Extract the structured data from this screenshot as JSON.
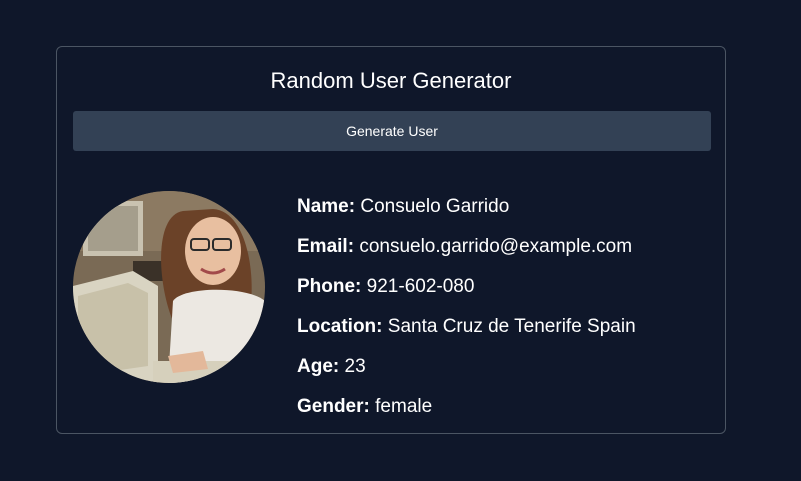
{
  "app": {
    "title": "Random User Generator",
    "generate_label": "Generate User"
  },
  "user": {
    "fields": [
      {
        "label": "Name:",
        "value": "Consuelo Garrido"
      },
      {
        "label": "Email:",
        "value": "consuelo.garrido@example.com"
      },
      {
        "label": "Phone:",
        "value": "921-602-080"
      },
      {
        "label": "Location:",
        "value": "Santa Cruz de Tenerife Spain"
      },
      {
        "label": "Age:",
        "value": "23"
      },
      {
        "label": "Gender:",
        "value": "female"
      }
    ]
  },
  "colors": {
    "background": "#0f172a",
    "card_border": "#4b5563",
    "button": "#334155"
  }
}
